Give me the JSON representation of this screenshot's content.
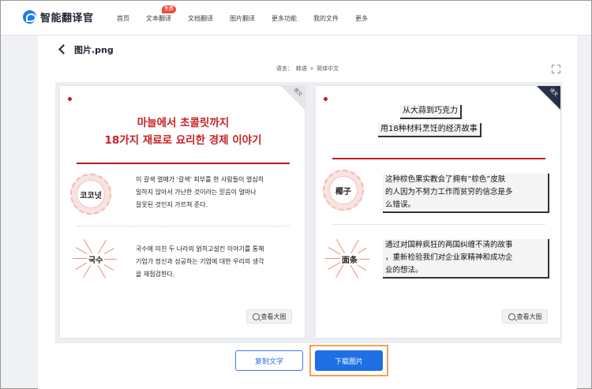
{
  "app": {
    "name": "智能翻译官",
    "brand_color": "#1c7cf4"
  },
  "nav": {
    "items": [
      "首页",
      "文本翻译",
      "文档翻译",
      "图片翻译",
      "更多功能",
      "我的文件",
      "更多"
    ],
    "badge": "免费"
  },
  "page": {
    "title": "图片.png",
    "back_icon": "chevron-left-icon"
  },
  "language": {
    "prefix": "语言：",
    "source": "韩语",
    "arrow": "»",
    "target": "简体中文"
  },
  "original": {
    "corner_label": "原文",
    "title_line1": "마늘에서 초콜릿까지",
    "title_line2": "18가지 재료로 요리한 경제 이야기",
    "item1_label": "코코넛",
    "item1_text_line1": "이 갈색 열매가 '갈색' 피부를 한 사람들이 열심히",
    "item1_text_line2": "일하지 않아서 가난한 것이라는 믿음이 얼마나",
    "item1_text_line3": "잘못된 것인지 가르쳐 준다.",
    "item2_label": "국수",
    "item2_text_line1": "국수에 미친 두 나라의 얽히고설킨 이야기를 통해",
    "item2_text_line2": "기업가 정신과 성공하는 기업에 대한 우리의 생각",
    "item2_text_line3": "을 재점검한다.",
    "zoom_label": "查看大图"
  },
  "translated": {
    "corner_label": "译文",
    "title_line1": "从大蒜到巧克力",
    "title_line2": "用18种材料烹饪的经济故事",
    "item1_label": "椰子",
    "item1_text_line1": "这种棕色果实教会了拥有“棕色”皮肤",
    "item1_text_line2": "的人因为不努力工作而贫穷的信念是多",
    "item1_text_line3": "么错误。",
    "item2_label": "面条",
    "item2_text_line1": "通过对国粹疯狂的两国纠缠不清的故事",
    "item2_text_line2": "，重新检验我们对企业家精神和成功企",
    "item2_text_line3": "业的想法。",
    "zoom_label": "查看大图"
  },
  "actions": {
    "copy_text": "复制文字",
    "download_image": "下载图片"
  },
  "colors": {
    "accent": "#1e6fe6",
    "highlight": "#f5a154",
    "poster_red": "#c92222"
  }
}
